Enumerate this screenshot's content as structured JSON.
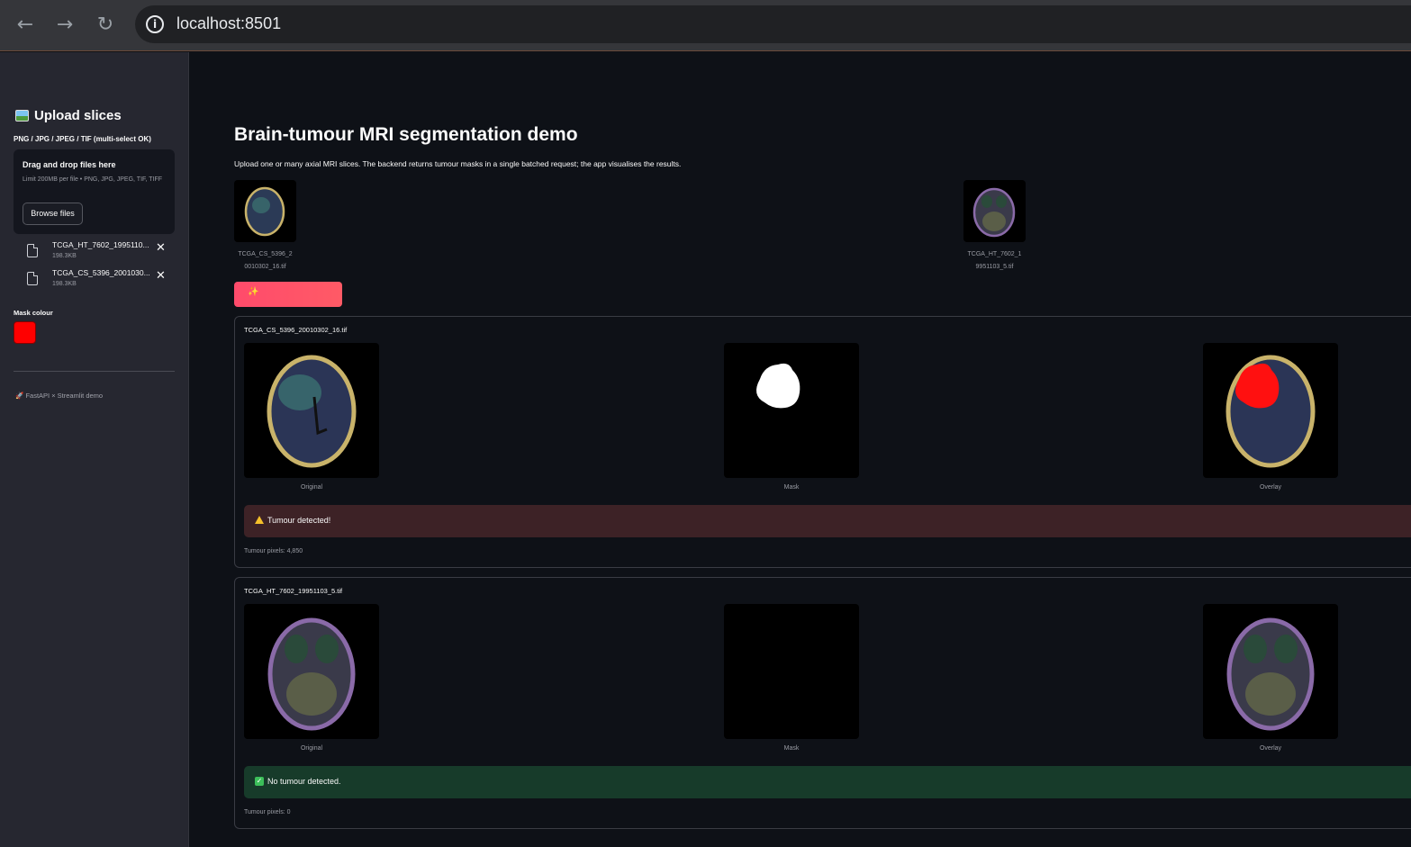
{
  "browser": {
    "url": "localhost:8501"
  },
  "sidebar": {
    "title": "Upload slices",
    "hint": "PNG / JPG / JPEG / TIF (multi-select OK)",
    "dropzone_title": "Drag and drop files here",
    "dropzone_limit": "Limit 200MB per file • PNG, JPG, JPEG, TIF, TIFF",
    "browse_label": "Browse files",
    "files": [
      {
        "name": "TCGA_HT_7602_1995110...",
        "size": "198.3KB"
      },
      {
        "name": "TCGA_CS_5396_2001030...",
        "size": "198.3KB"
      }
    ],
    "mask_label": "Mask colour",
    "mask_color": "#ff0000",
    "footer": "FastAPI × Streamlit demo"
  },
  "main": {
    "title": "Brain-tumour MRI segmentation demo",
    "description": "Upload one or many axial MRI slices. The backend returns tumour masks in a single batched request; the app visualises the results.",
    "thumbnails": [
      {
        "caption_line1": "TCGA_CS_5396_2",
        "caption_line2": "0010302_16.tif"
      },
      {
        "caption_line1": "TCGA_HT_7602_1",
        "caption_line2": "9951103_5.tif"
      }
    ],
    "segment_button_icon": "sparkles-icon",
    "results": [
      {
        "filename": "TCGA_CS_5396_20010302_16.tif",
        "captions": [
          "Original",
          "Mask",
          "Overlay"
        ],
        "status": "Tumour detected!",
        "status_type": "warning",
        "pixels": "Tumour pixels: 4,850"
      },
      {
        "filename": "TCGA_HT_7602_19951103_5.tif",
        "captions": [
          "Original",
          "Mask",
          "Overlay"
        ],
        "status": "No tumour detected.",
        "status_type": "success",
        "pixels": "Tumour pixels: 0"
      }
    ]
  }
}
